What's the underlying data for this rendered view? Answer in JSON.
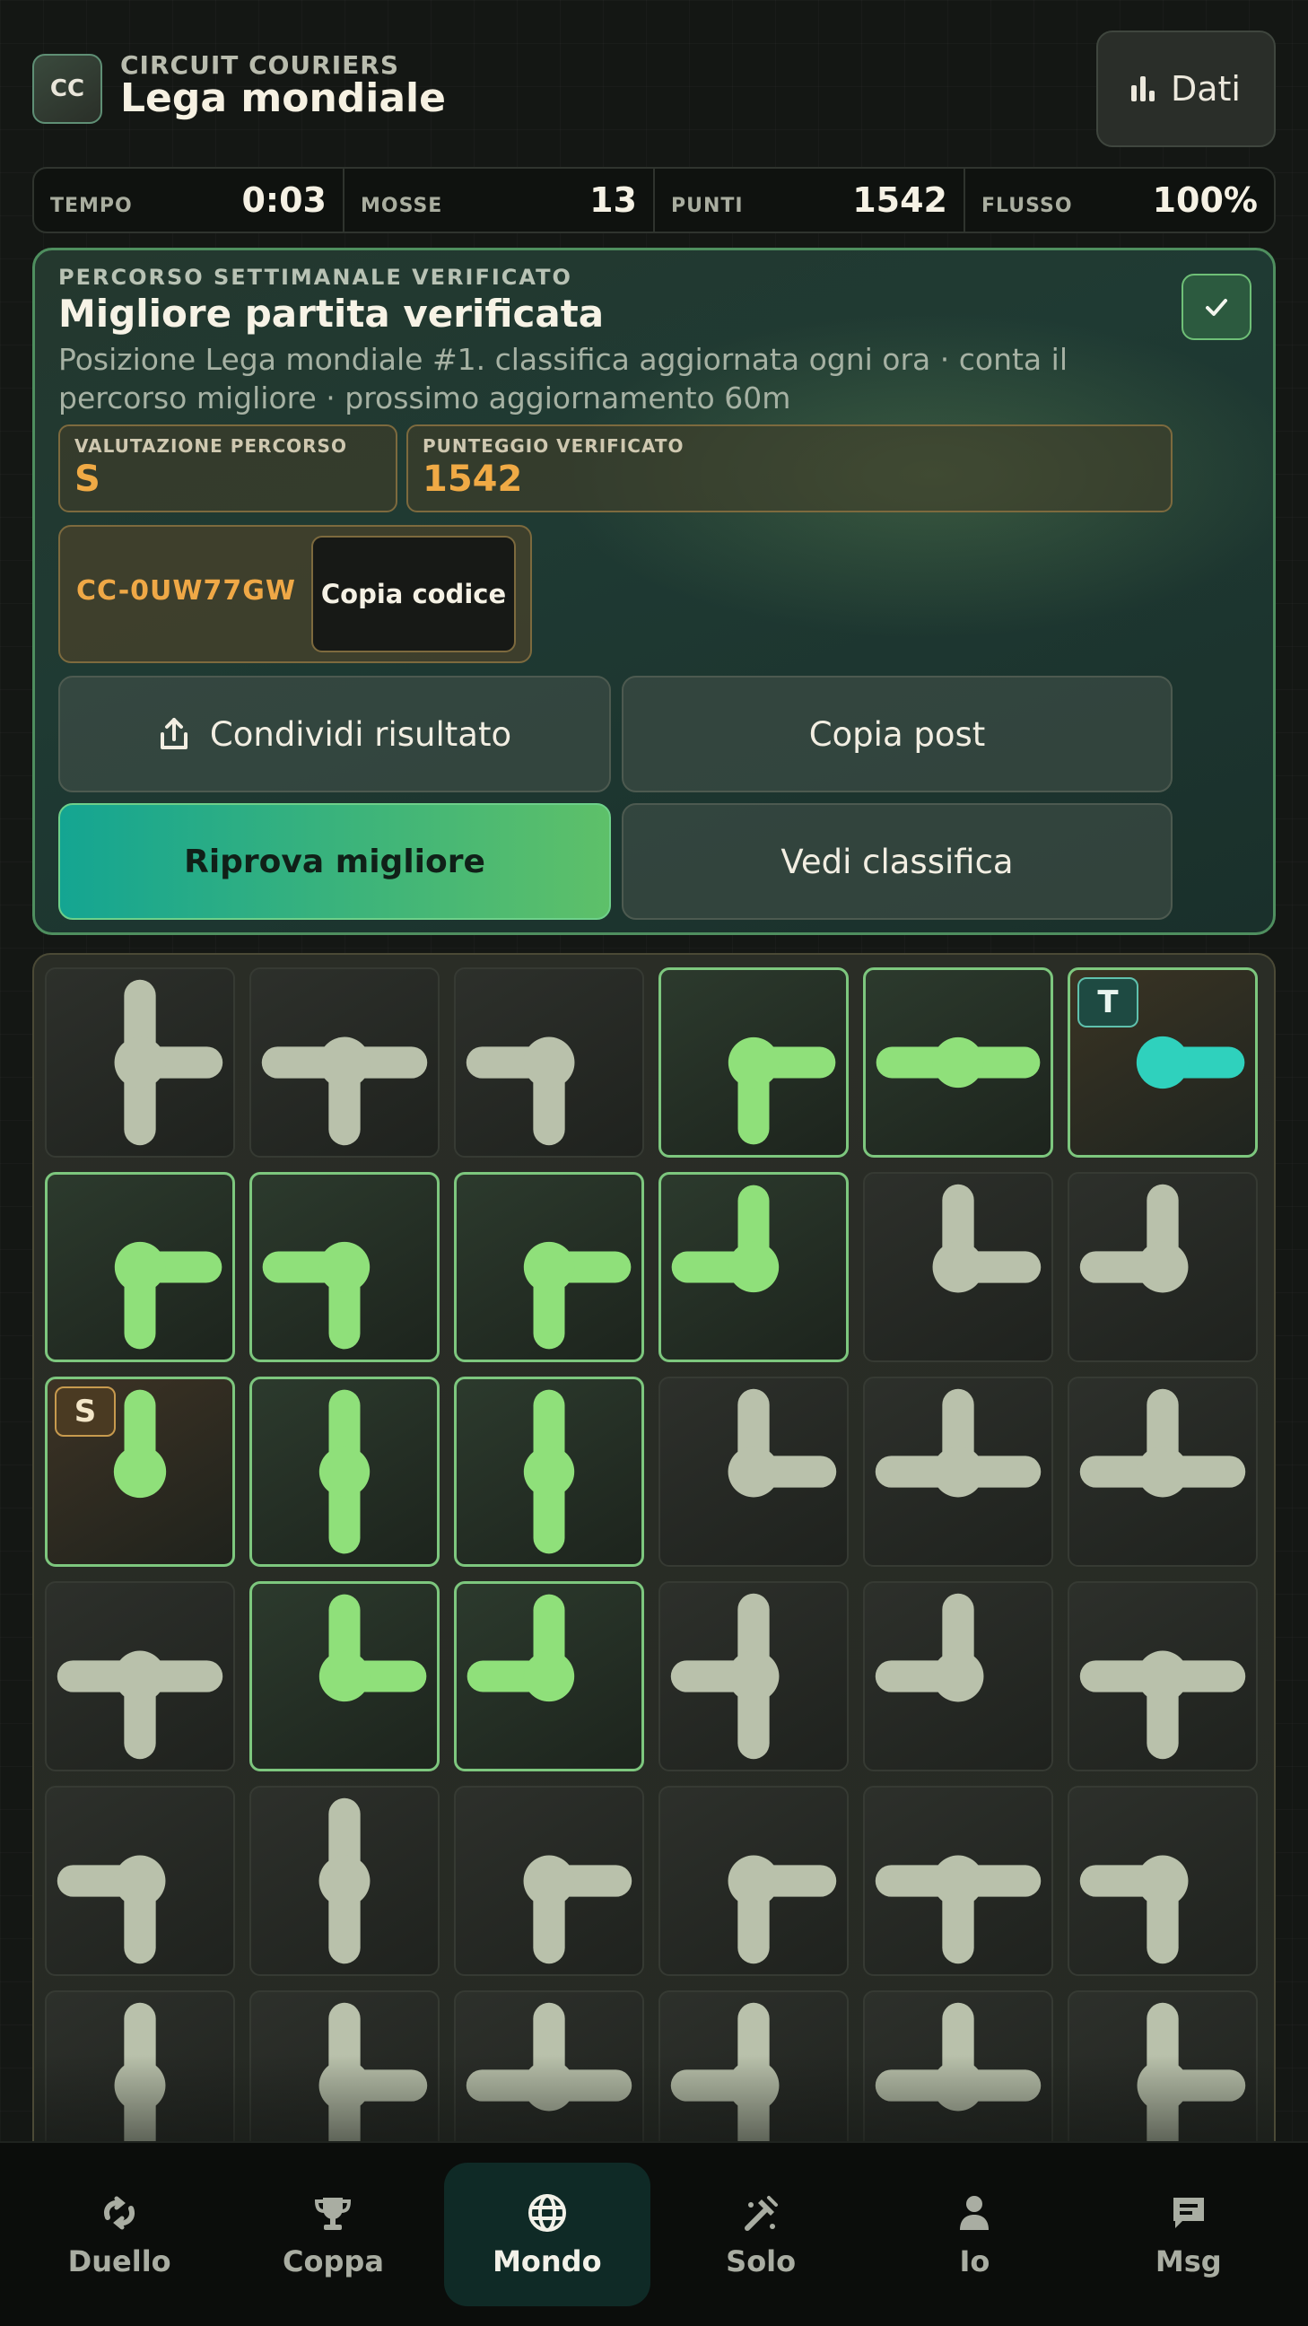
{
  "header": {
    "logo": "CC",
    "brand": "CIRCUIT COURIERS",
    "title": "Lega mondiale",
    "stats_button": "Dati"
  },
  "stats": [
    {
      "label": "TEMPO",
      "value": "0:03"
    },
    {
      "label": "MOSSE",
      "value": "13"
    },
    {
      "label": "PUNTI",
      "value": "1542"
    },
    {
      "label": "FLUSSO",
      "value": "100%"
    }
  ],
  "result": {
    "kicker": "PERCORSO SETTIMANALE VERIFICATO",
    "title": "Migliore partita verificata",
    "description": "Posizione Lega mondiale #1. classifica aggiornata ogni ora · conta il percorso migliore · prossimo aggiornamento 60m",
    "rating_label": "VALUTAZIONE PERCORSO",
    "rating_value": "S",
    "score_label": "PUNTEGGIO VERIFICATO",
    "score_value": "1542",
    "code": "CC-0UW77GW",
    "copy_code": "Copia codice",
    "share": "Condividi risultato",
    "copy_post": "Copia post",
    "retry": "Riprova migliore",
    "leaderboard": "Vedi classifica"
  },
  "board": {
    "source_label": "S",
    "target_label": "T",
    "colors": {
      "idle": "#b9c1ab",
      "active": "#8fe07a",
      "target": "#2fd1bd"
    },
    "tiles": [
      [
        {
          "arms": "NSE",
          "state": "idle"
        },
        {
          "arms": "WES",
          "state": "idle"
        },
        {
          "arms": "WS",
          "state": "idle"
        },
        {
          "arms": "SE",
          "state": "active"
        },
        {
          "arms": "WE",
          "state": "active"
        },
        {
          "arms": "E",
          "state": "target"
        }
      ],
      [
        {
          "arms": "SE",
          "state": "active"
        },
        {
          "arms": "WS",
          "state": "active"
        },
        {
          "arms": "SE",
          "state": "active"
        },
        {
          "arms": "NW",
          "state": "active"
        },
        {
          "arms": "NE",
          "state": "idle"
        },
        {
          "arms": "NW",
          "state": "idle"
        }
      ],
      [
        {
          "arms": "N",
          "state": "source"
        },
        {
          "arms": "NS",
          "state": "active"
        },
        {
          "arms": "NS",
          "state": "active"
        },
        {
          "arms": "NE",
          "state": "idle"
        },
        {
          "arms": "NWE",
          "state": "idle"
        },
        {
          "arms": "NWE",
          "state": "idle"
        }
      ],
      [
        {
          "arms": "WES",
          "state": "idle"
        },
        {
          "arms": "NE",
          "state": "active"
        },
        {
          "arms": "NW",
          "state": "active"
        },
        {
          "arms": "NSW",
          "state": "idle"
        },
        {
          "arms": "NW",
          "state": "idle"
        },
        {
          "arms": "WES",
          "state": "idle"
        }
      ],
      [
        {
          "arms": "WS",
          "state": "idle"
        },
        {
          "arms": "NS",
          "state": "idle"
        },
        {
          "arms": "SE",
          "state": "idle"
        },
        {
          "arms": "SE",
          "state": "idle"
        },
        {
          "arms": "WES",
          "state": "idle"
        },
        {
          "arms": "WS",
          "state": "idle"
        }
      ],
      [
        {
          "arms": "NS",
          "state": "idle"
        },
        {
          "arms": "NSE",
          "state": "idle"
        },
        {
          "arms": "NWE",
          "state": "idle"
        },
        {
          "arms": "NWS",
          "state": "idle"
        },
        {
          "arms": "NWE",
          "state": "idle"
        },
        {
          "arms": "NSE",
          "state": "idle"
        }
      ]
    ]
  },
  "nav": [
    {
      "label": "Duello",
      "icon": "duel-icon",
      "active": false
    },
    {
      "label": "Coppa",
      "icon": "trophy-icon",
      "active": false
    },
    {
      "label": "Mondo",
      "icon": "globe-icon",
      "active": true
    },
    {
      "label": "Solo",
      "icon": "tools-icon",
      "active": false
    },
    {
      "label": "Io",
      "icon": "person-icon",
      "active": false
    },
    {
      "label": "Msg",
      "icon": "message-icon",
      "active": false
    }
  ]
}
